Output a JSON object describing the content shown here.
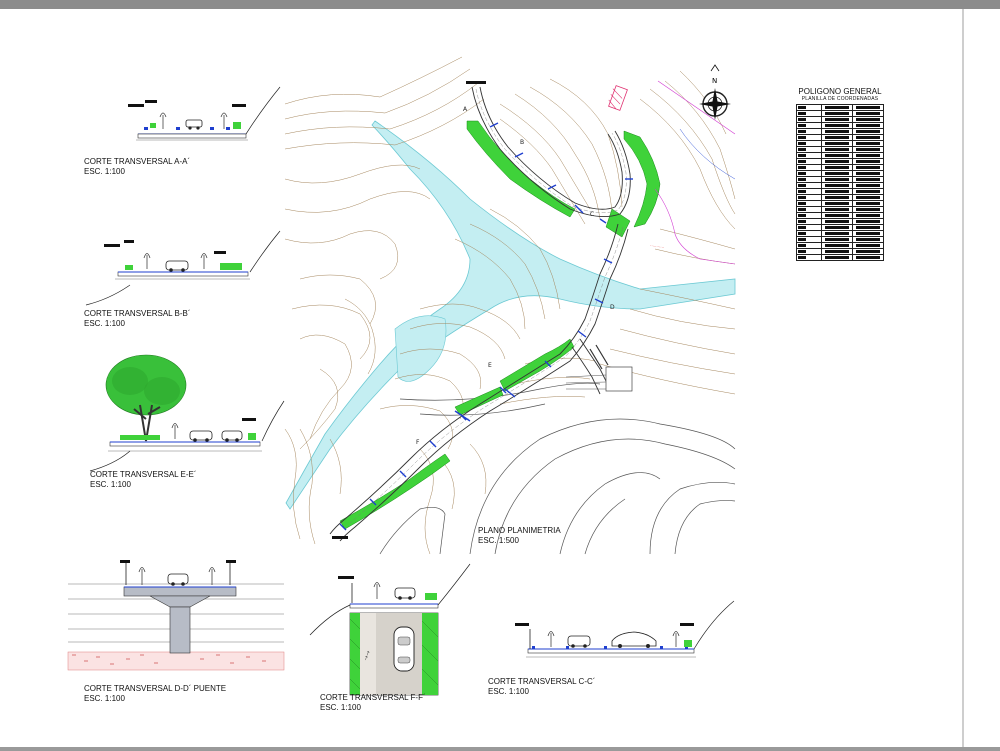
{
  "sections": {
    "aa": {
      "title": "CORTE TRANSVERSAL A-A´",
      "scale": "ESC. 1:100"
    },
    "bb": {
      "title": "CORTE TRANSVERSAL B-B´",
      "scale": "ESC. 1:100"
    },
    "ee": {
      "title": "CORTE TRANSVERSAL E-E´",
      "scale": "ESC. 1:100"
    },
    "dd": {
      "title": "CORTE TRANSVERSAL D-D´ PUENTE",
      "scale": "ESC. 1:100"
    },
    "ff": {
      "title": "CORTE TRANSVERSAL F-F´",
      "scale": "ESC. 1:100"
    },
    "cc": {
      "title": "CORTE TRANSVERSAL C-C´",
      "scale": "ESC. 1:100"
    }
  },
  "plan": {
    "title": "PLANO PLANIMETRIA",
    "scale": "ESC. 1:500"
  },
  "polygon_table": {
    "title": "POLIGONO GENERAL",
    "subtitle": "PLANILLA DE COORDENADAS",
    "rows": 26
  },
  "colors": {
    "green": "#33cc33",
    "water": "#b8ecf0",
    "contour": "#9a7a4e",
    "road": "#444444",
    "blue": "#1f3fcf"
  }
}
